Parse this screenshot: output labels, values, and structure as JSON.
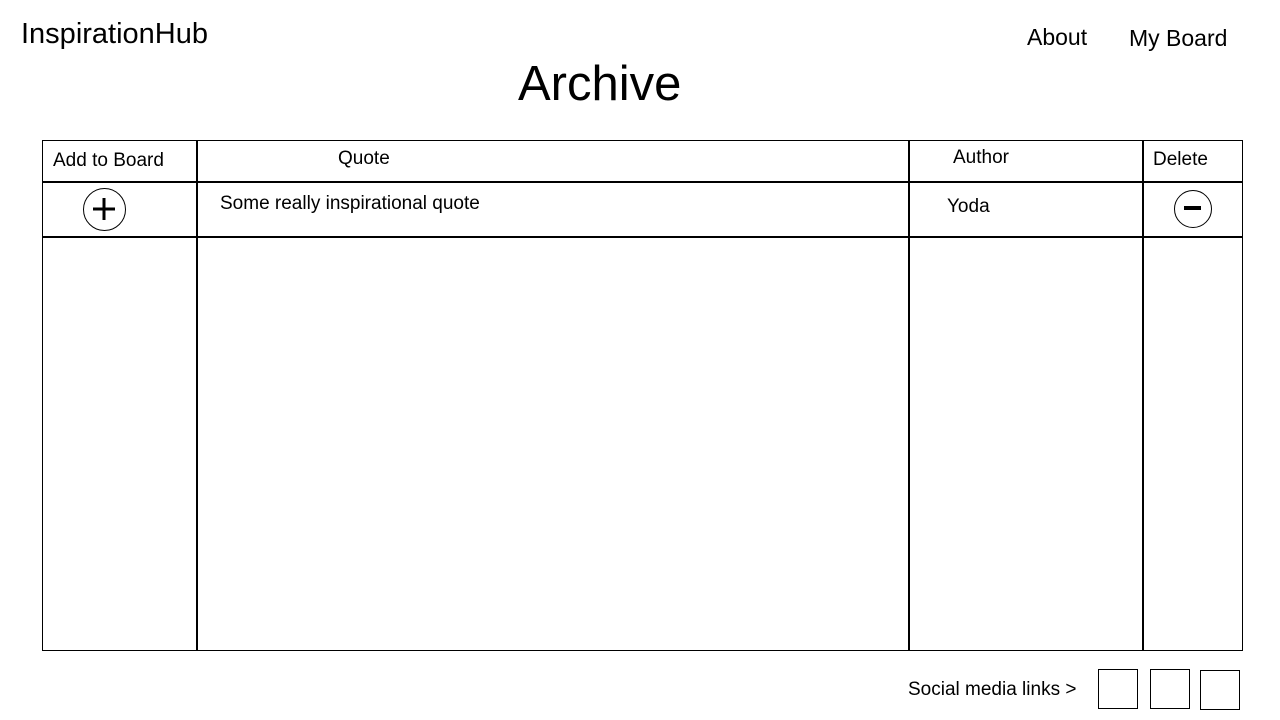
{
  "header": {
    "brand": "InspirationHub",
    "nav": {
      "about": "About",
      "my_board": "My Board"
    }
  },
  "page": {
    "title": "Archive"
  },
  "table": {
    "columns": {
      "add": "Add to Board",
      "quote": "Quote",
      "author": "Author",
      "delete": "Delete"
    },
    "rows": [
      {
        "add_icon": "plus-circle-icon",
        "quote": "Some really inspirational quote",
        "author": "Yoda",
        "delete_icon": "minus-circle-icon"
      }
    ]
  },
  "footer": {
    "social_label": "Social media links >",
    "social_links": [
      "social-link-1",
      "social-link-2",
      "social-link-3"
    ]
  }
}
